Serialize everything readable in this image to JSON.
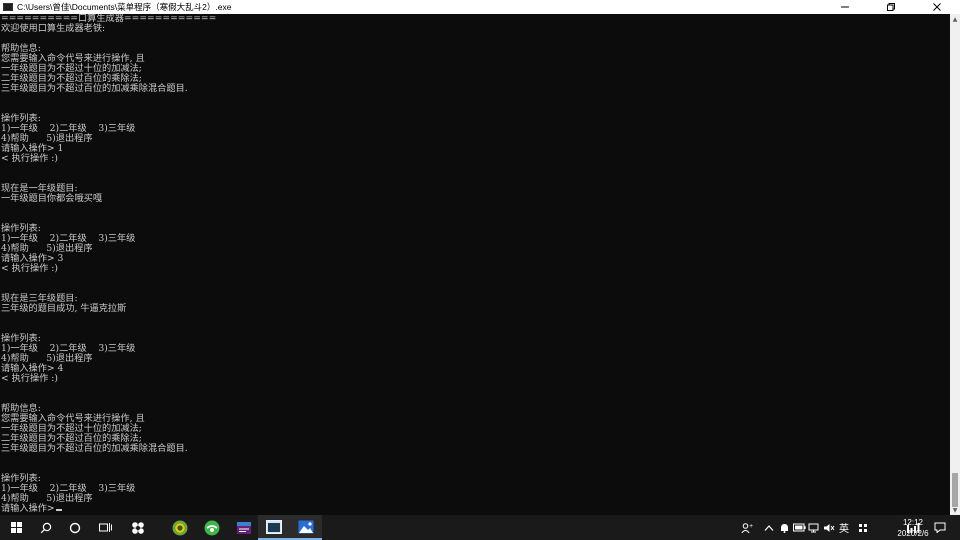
{
  "window": {
    "title": "C:\\Users\\曾佳\\Documents\\菜单程序（寒假大乱斗2）.exe",
    "minimize_icon": "minimize-icon",
    "maximize_icon": "restore-icon",
    "close_icon": "close-icon"
  },
  "console": {
    "lines": [
      "==========口算生成器============",
      "欢迎使用口算生成器老铁:",
      "",
      "帮助信息:",
      "您需要输入命令代号来进行操作, 且",
      "一年级题目为不超过十位的加减法;",
      "二年级题目为不超过百位的乘除法;",
      "三年级题目为不超过百位的加减乘除混合题目.",
      "",
      "",
      "操作列表:",
      "1)一年级    2)二年级    3)三年级",
      "4)帮助      5)退出程序",
      "请输入操作> 1",
      "< 执行操作 :)",
      "",
      "",
      "现在是一年级题目:",
      "一年级题目你都会哦买嘎",
      "",
      "",
      "操作列表:",
      "1)一年级    2)二年级    3)三年级",
      "4)帮助      5)退出程序",
      "请输入操作> 3",
      "< 执行操作 :)",
      "",
      "",
      "现在是三年级题目:",
      "三年级的题目成功, 牛逼克拉斯",
      "",
      "",
      "操作列表:",
      "1)一年级    2)二年级    3)三年级",
      "4)帮助      5)退出程序",
      "请输入操作> 4",
      "< 执行操作 :)",
      "",
      "",
      "帮助信息:",
      "您需要输入命令代号来进行操作, 且",
      "一年级题目为不超过十位的加减法;",
      "二年级题目为不超过百位的乘除法;",
      "三年级题目为不超过百位的加减乘除混合题目.",
      "",
      "",
      "操作列表:",
      "1)一年级    2)二年级    3)三年级",
      "4)帮助      5)退出程序",
      "请输入操作>"
    ]
  },
  "taskbar": {
    "icons": [
      "windows-start-icon",
      "search-icon",
      "cortana-icon",
      "task-view-icon",
      "app-icon",
      "chrome-browser-icon",
      "green-browser-icon",
      "visual-studio-icon",
      "console-window-icon",
      "photos-icon"
    ],
    "tray": {
      "ime_label": "英",
      "time": "12:12",
      "date": "2020/2/6"
    }
  },
  "colors": {
    "console_bg": "#0c0c0c",
    "console_fg": "#cccccc",
    "taskbar_bg": "#1a1a1a",
    "accent": "#7fb2e5"
  }
}
